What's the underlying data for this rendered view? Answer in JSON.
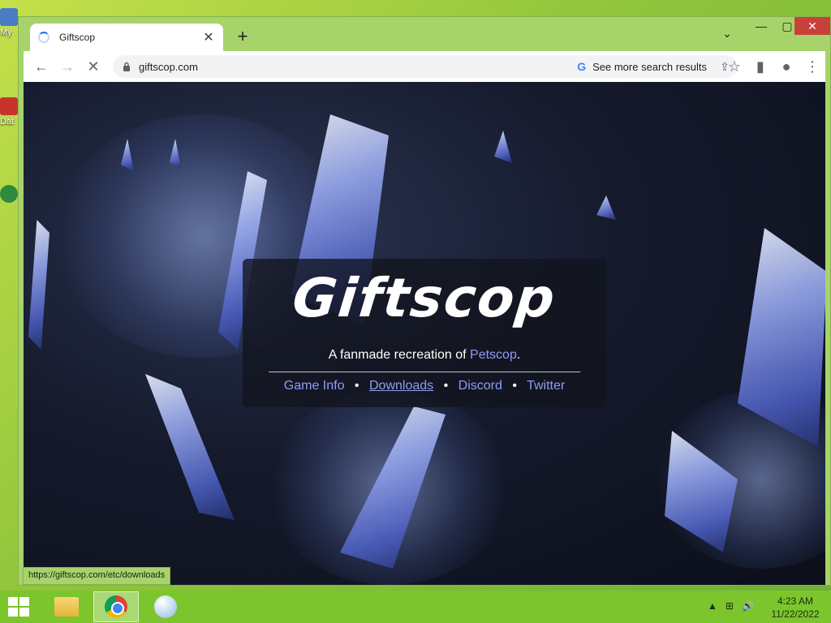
{
  "desktop": {
    "icons": [
      {
        "label": "My"
      },
      {
        "label": "Dat"
      }
    ]
  },
  "browser": {
    "tab": {
      "title": "Giftscop"
    },
    "new_tab_symbol": "+",
    "tab_search_symbol": "⌄",
    "window_controls": {
      "minimize": "—",
      "maximize": "▢",
      "close": "✕"
    },
    "toolbar": {
      "back": "←",
      "forward": "→",
      "stop": "✕",
      "url": "giftscop.com",
      "search_chip": "See more search results",
      "search_chip_icon": "G",
      "share_icon": "⇪",
      "bookmark_icon": "☆",
      "side_panel_icon": "▮",
      "profile_icon": "●",
      "menu_icon": "⋮"
    },
    "status_url": "https://giftscop.com/etc/downloads"
  },
  "page": {
    "title": "Giftscop",
    "subtitle_prefix": "A fanmade recreation of ",
    "subtitle_link": "Petscop",
    "subtitle_suffix": ".",
    "nav": [
      {
        "label": "Game Info"
      },
      {
        "label": "Downloads"
      },
      {
        "label": "Discord"
      },
      {
        "label": "Twitter"
      }
    ],
    "nav_separator": "•",
    "link_color": "#8e9cf5"
  },
  "taskbar": {
    "tray": {
      "chevron": "▲",
      "network": "⊞",
      "volume": "🔊"
    },
    "clock": {
      "time": "4:23 AM",
      "date": "11/22/2022"
    }
  }
}
